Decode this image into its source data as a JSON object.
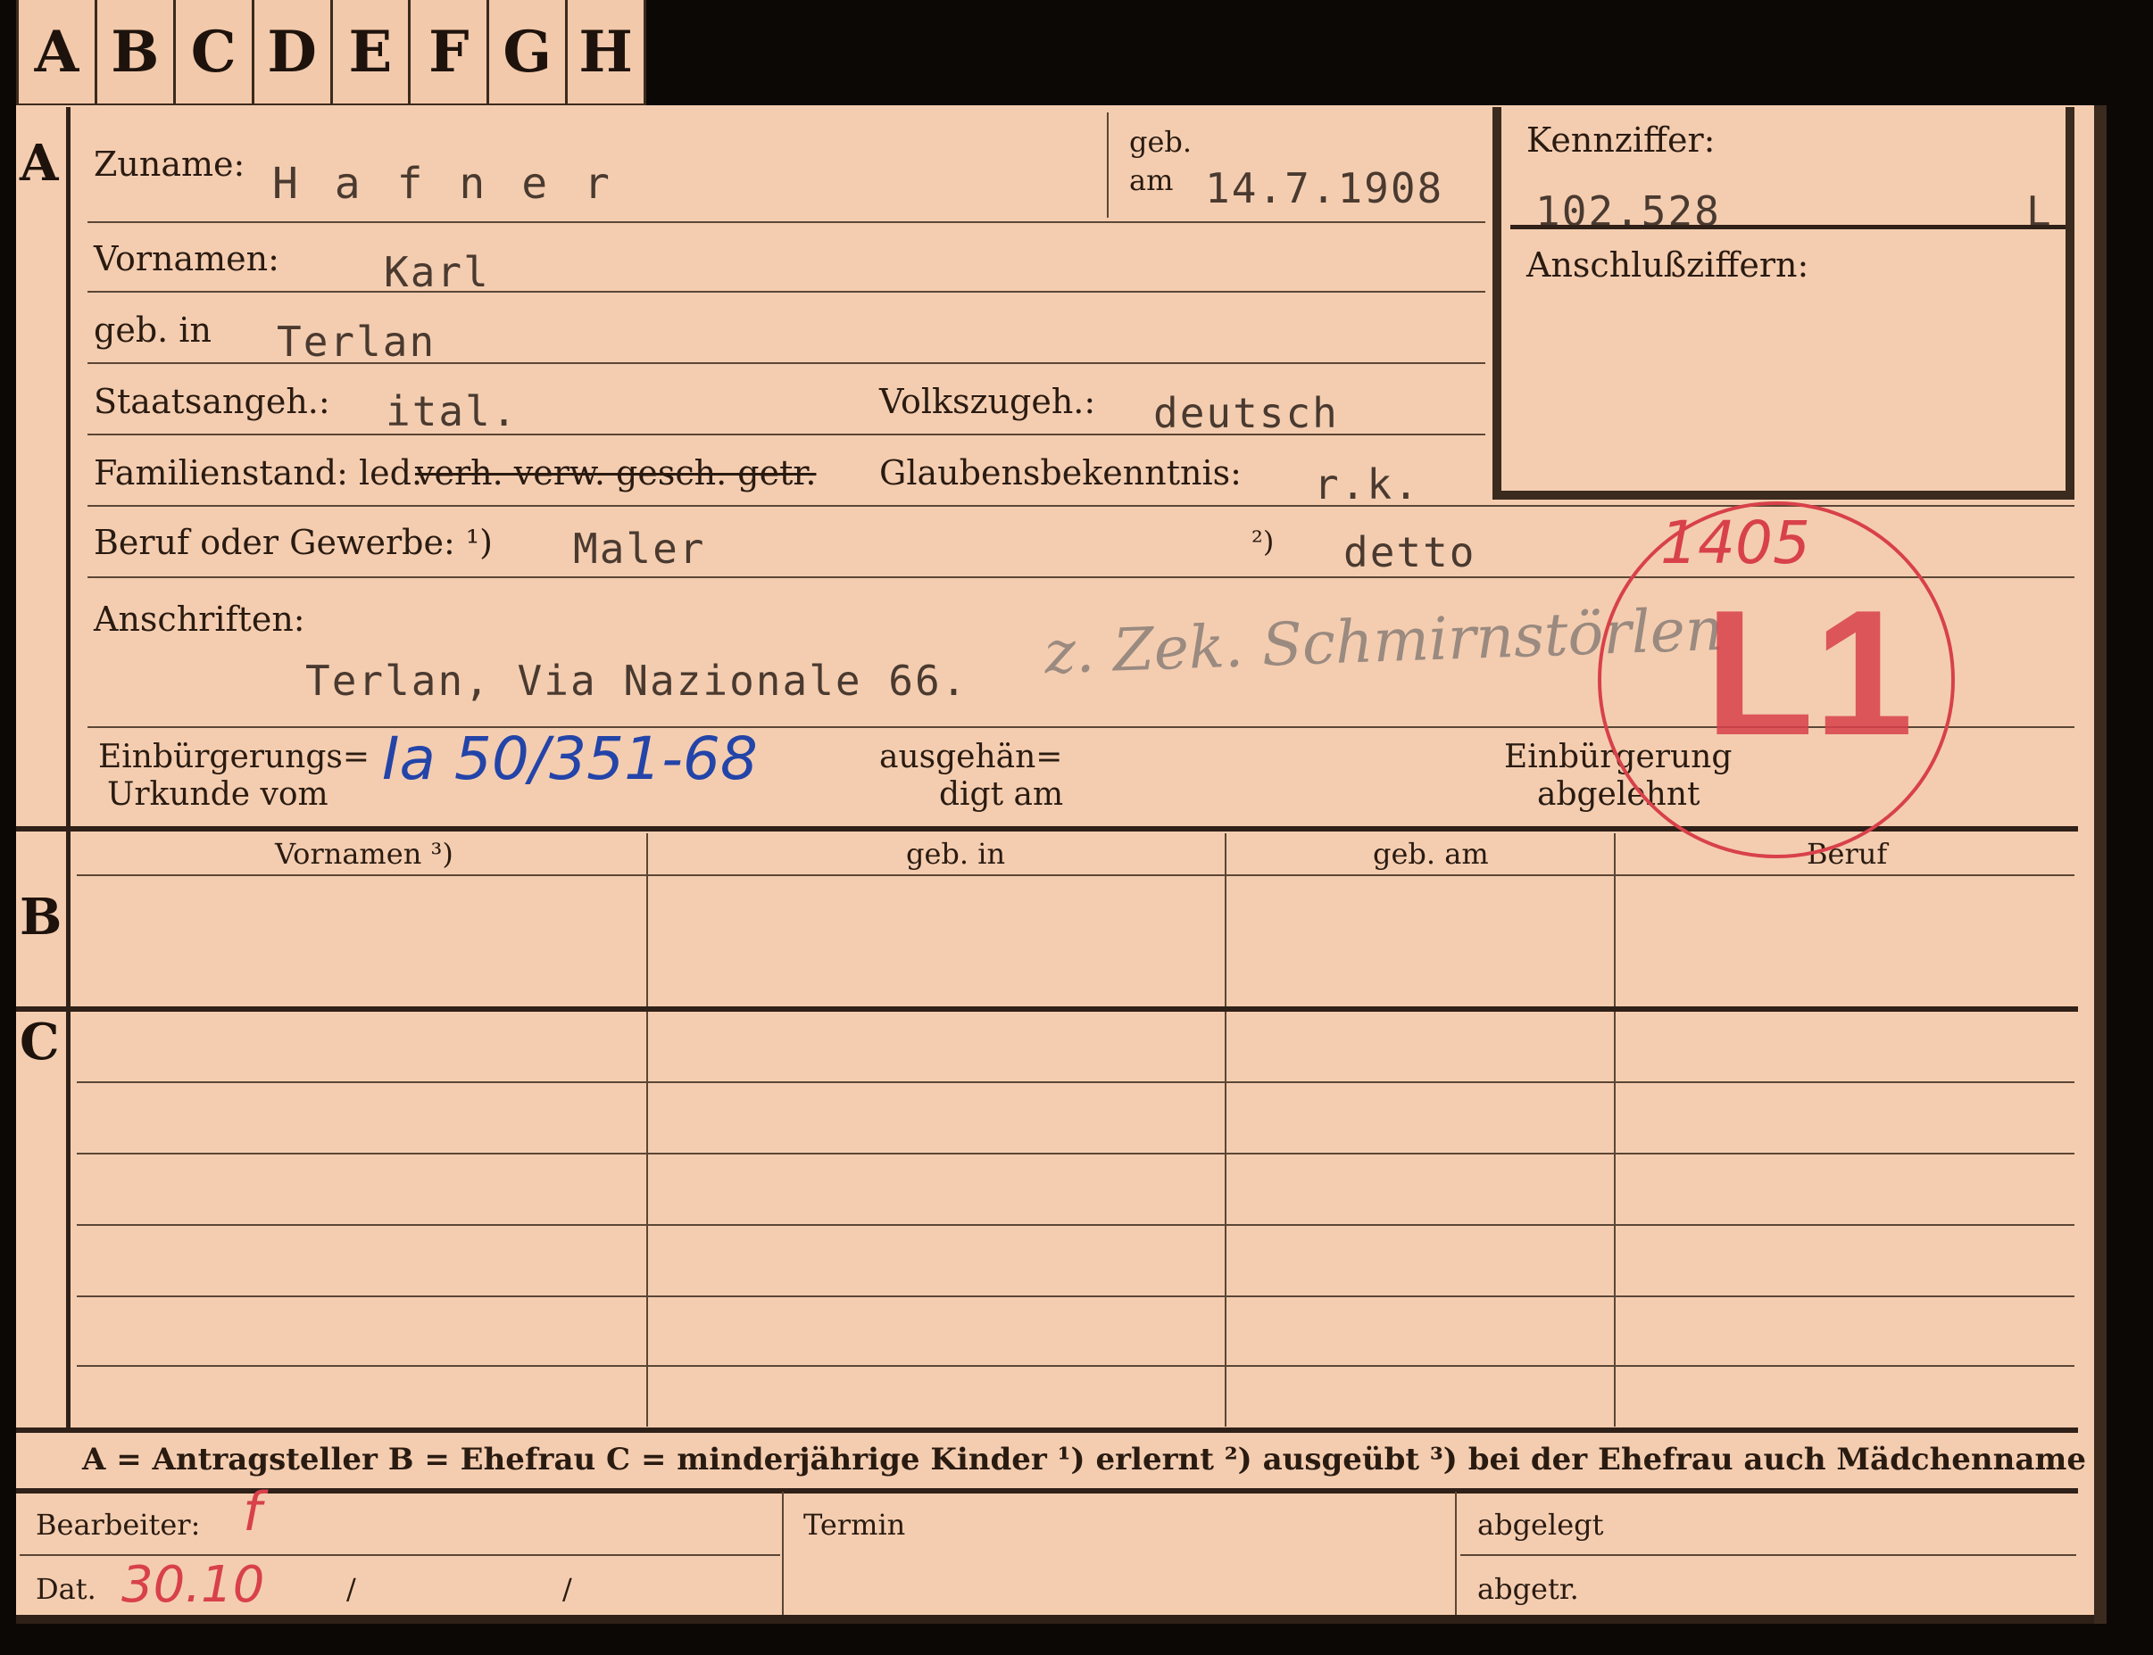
{
  "tabs": [
    "A",
    "B",
    "C",
    "D",
    "E",
    "F",
    "G",
    "H"
  ],
  "sections": {
    "a": "A",
    "b": "B",
    "c": "C"
  },
  "header": {
    "zuname_label": "Zuname:",
    "zuname_value": "H a f n e r",
    "geb_label": "geb.",
    "am_label": "am",
    "geb_am_value": "14.7.1908",
    "kennziffer_label": "Kennziffer:",
    "kennziffer_value": "102.528",
    "kennziffer_suffix": "L",
    "anschluss_label": "Anschlußziffern:"
  },
  "person": {
    "vornamen_label": "Vornamen:",
    "vornamen_value": "Karl",
    "geb_in_label": "geb. in",
    "geb_in_value": "Terlan",
    "staatsangeh_label": "Staatsangeh.:",
    "staatsangeh_value": "ital.",
    "volkszugeh_label": "Volkszugeh.:",
    "volkszugeh_value": "deutsch",
    "familienstand_label": "Familienstand: led.",
    "familienstand_struck": "verh. verw. gesch. getr.",
    "glauben_label": "Glaubensbekenntnis:",
    "glauben_value": "r.k.",
    "beruf_label": "Beruf oder Gewerbe: ¹)",
    "beruf_value": "Maler",
    "beruf2_marker": "²)",
    "beruf2_value": "detto",
    "anschriften_label": "Anschriften:",
    "anschriften_value": "Terlan, Via Nazionale 66.",
    "pencil_note": "z. Zek. Schmirnstörlen",
    "einb_label_1": "Einbürgerungs=",
    "einb_label_2": "Urkunde vom",
    "einb_value": "Ia 50/351-68",
    "ausg_label_1": "ausgehän=",
    "ausg_label_2": "digt am",
    "abgelehnt_label_1": "Einbürgerung",
    "abgelehnt_label_2": "abgelehnt"
  },
  "stamp": {
    "number": "1405",
    "code": "L1",
    "color": "#d8414a"
  },
  "table": {
    "columns": [
      "Vornamen ³)",
      "geb. in",
      "geb. am",
      "Beruf"
    ]
  },
  "legend": "A = Antragsteller   B = Ehefrau   C = minderjährige Kinder   ¹) erlernt   ²) ausgeübt   ³) bei der Ehefrau auch Mädchenname",
  "footer": {
    "bearbeiter_label": "Bearbeiter:",
    "bearbeiter_mark": "f",
    "dat_label": "Dat.",
    "dat_value": "30.10",
    "slash": "/",
    "termin_label": "Termin",
    "abgelegt_label": "abgelegt",
    "abgetr_label": "abgetr."
  },
  "colors": {
    "card": "#f4cdb0",
    "ink": "#2a1b11",
    "blue_ink": "#2344a8",
    "red_ink": "#d8414a",
    "background": "#0c0805"
  }
}
